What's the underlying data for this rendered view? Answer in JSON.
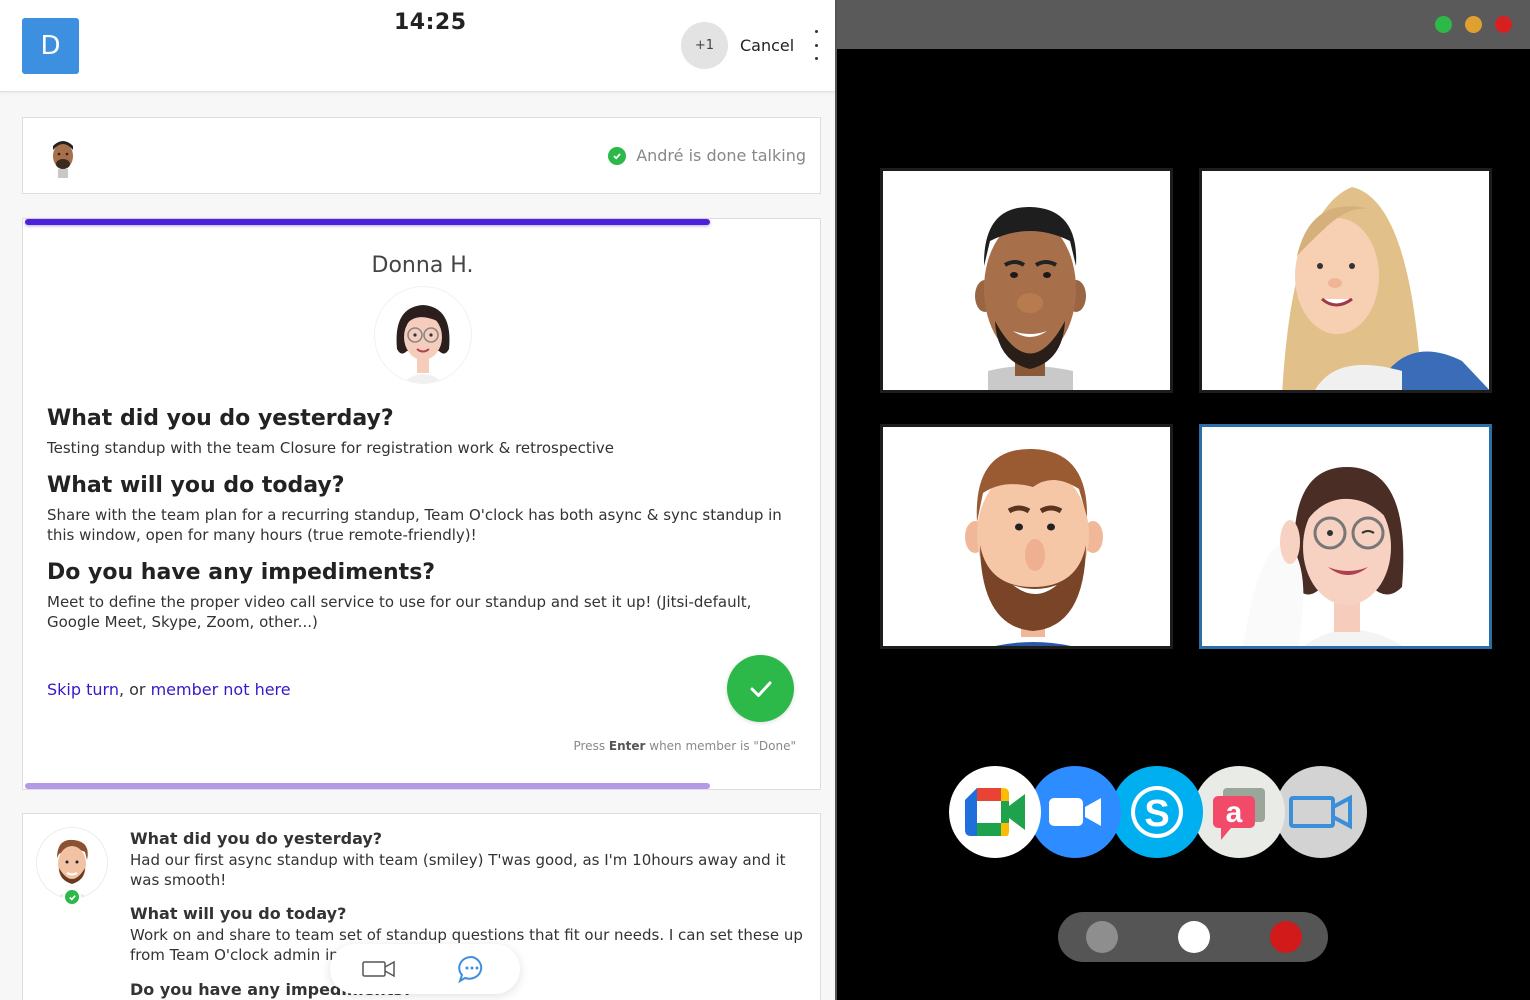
{
  "header": {
    "logo_letter": "D",
    "timer": "14:25",
    "extra_participants": "+1",
    "cancel_label": "Cancel"
  },
  "previous_member": {
    "status_text": "André is done talking"
  },
  "current_member": {
    "name": "Donna H.",
    "questions": [
      {
        "question": "What did you do yesterday?",
        "answer": "Testing standup with the team Closure for registration work & retrospective"
      },
      {
        "question": "What will you do today?",
        "answer": "Share with the team plan for a recurring standup, Team O'clock has both async & sync standup in this window, open for many hours (true remote-friendly)!"
      },
      {
        "question": "Do you have any impediments?",
        "answer": "Meet to define the proper video call service to use for our standup and set it up! (Jitsi-default, Google Meet, Skype, Zoom, other...)"
      }
    ],
    "skip_label": "Skip turn",
    "separator": ", or ",
    "not_here_label": "member not here",
    "press_hint_prefix": "Press ",
    "press_hint_key": "Enter",
    "press_hint_suffix": " when member is \"Done\""
  },
  "async_member": {
    "questions": [
      {
        "question": "What did you do yesterday?",
        "answer": "Had our first async standup with team (smiley) T'was good, as I'm 10hours away and it was smooth!"
      },
      {
        "question": "What will you do today?",
        "answer": "Work on and share to team set of standup questions that fit our needs. I can set these up from Team O'clock admin in"
      },
      {
        "question": "Do you have any impediments?",
        "answer": ""
      }
    ]
  },
  "floating_toolbar": {
    "icons": [
      "video-camera-icon",
      "chat-bubble-icon"
    ]
  },
  "video_window": {
    "traffic_lights": [
      "#2db84a",
      "#e0a030",
      "#d92020"
    ],
    "tile_count": 4,
    "active_tile": 4,
    "apps": [
      "google-meet-icon",
      "zoom-icon",
      "skype-icon",
      "whereby-icon",
      "jitsi-video-icon"
    ],
    "controls": [
      "gray-dot",
      "white-dot",
      "red-dot"
    ]
  },
  "colors": {
    "accent": "#4b22d8",
    "accent_light": "#b49ae6",
    "success": "#2db84a",
    "logo": "#3d8fe0",
    "link": "#3a17c9"
  }
}
